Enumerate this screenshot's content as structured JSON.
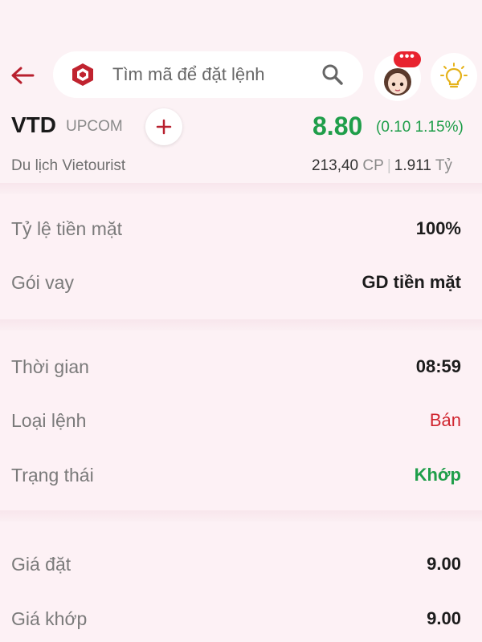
{
  "search": {
    "placeholder": "Tìm mã để đặt lệnh"
  },
  "header": {
    "notification_badge": "•••"
  },
  "stock": {
    "ticker": "VTD",
    "exchange": "UPCOM",
    "price": "8.80",
    "change": "(0.10 1.15%)",
    "company": "Du lịch Vietourist",
    "volume": "213,40",
    "volume_unit": "CP",
    "value": "1.911",
    "value_unit": "Tỷ"
  },
  "details": {
    "cash_ratio_label": "Tỷ lệ tiền mặt",
    "cash_ratio_value": "100%",
    "loan_label": "Gói vay",
    "loan_value": "GD tiền mặt",
    "time_label": "Thời gian",
    "time_value": "08:59",
    "order_type_label": "Loại lệnh",
    "order_type_value": "Bán",
    "status_label": "Trạng thái",
    "status_value": "Khớp",
    "order_price_label": "Giá đặt",
    "order_price_value": "9.00",
    "match_price_label": "Giá khớp",
    "match_price_value": "9.00"
  },
  "colors": {
    "brand": "#b8202e",
    "up": "#1f9e4a",
    "sell": "#d0252f",
    "background": "#fdf3f6"
  },
  "icons": {
    "back": "arrow-left-icon",
    "logo": "brand-logo-icon",
    "search": "search-icon",
    "avatar": "user-avatar",
    "idea": "lightbulb-icon",
    "add": "plus-icon"
  }
}
